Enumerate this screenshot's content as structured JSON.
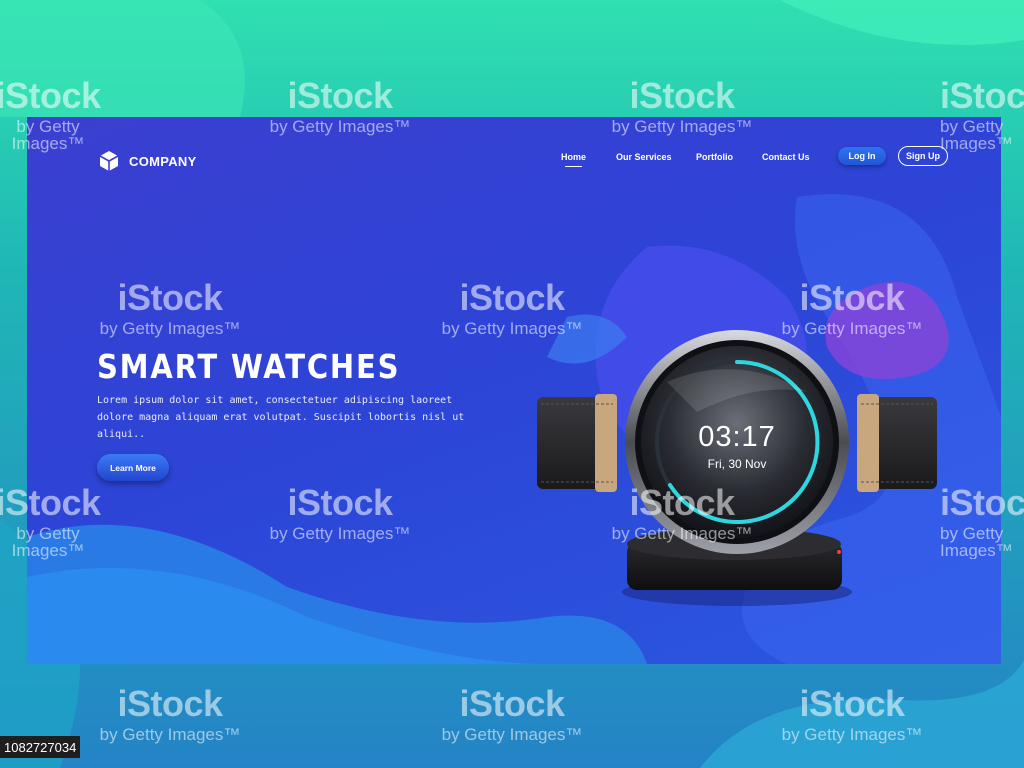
{
  "brand": {
    "name": "COMPANY",
    "icon": "cube-icon"
  },
  "nav": {
    "items": [
      {
        "label": "Home",
        "active": true
      },
      {
        "label": "Our Services",
        "active": false
      },
      {
        "label": "Portfolio",
        "active": false
      },
      {
        "label": "Contact Us",
        "active": false
      }
    ],
    "login_label": "Log In",
    "signup_label": "Sign Up"
  },
  "hero": {
    "title": "SMART WATCHES",
    "description": "Lorem ipsum dolor sit amet, consectetuer adipiscing laoreet dolore magna aliquam erat volutpat. Suscipit lobortis nisl ut aliqui..",
    "cta_label": "Learn More"
  },
  "watch": {
    "time": "03:17",
    "date": "Fri, 30 Nov"
  },
  "watermark": {
    "main": "iStock",
    "sub": "by Getty Images™"
  },
  "stock_id": "1082727034",
  "colors": {
    "outer_top": "#2fe0b0",
    "outer_bottom": "#2483c6",
    "frame_blue": "#3b3fd0",
    "accent_blue": "#2f73f0"
  }
}
